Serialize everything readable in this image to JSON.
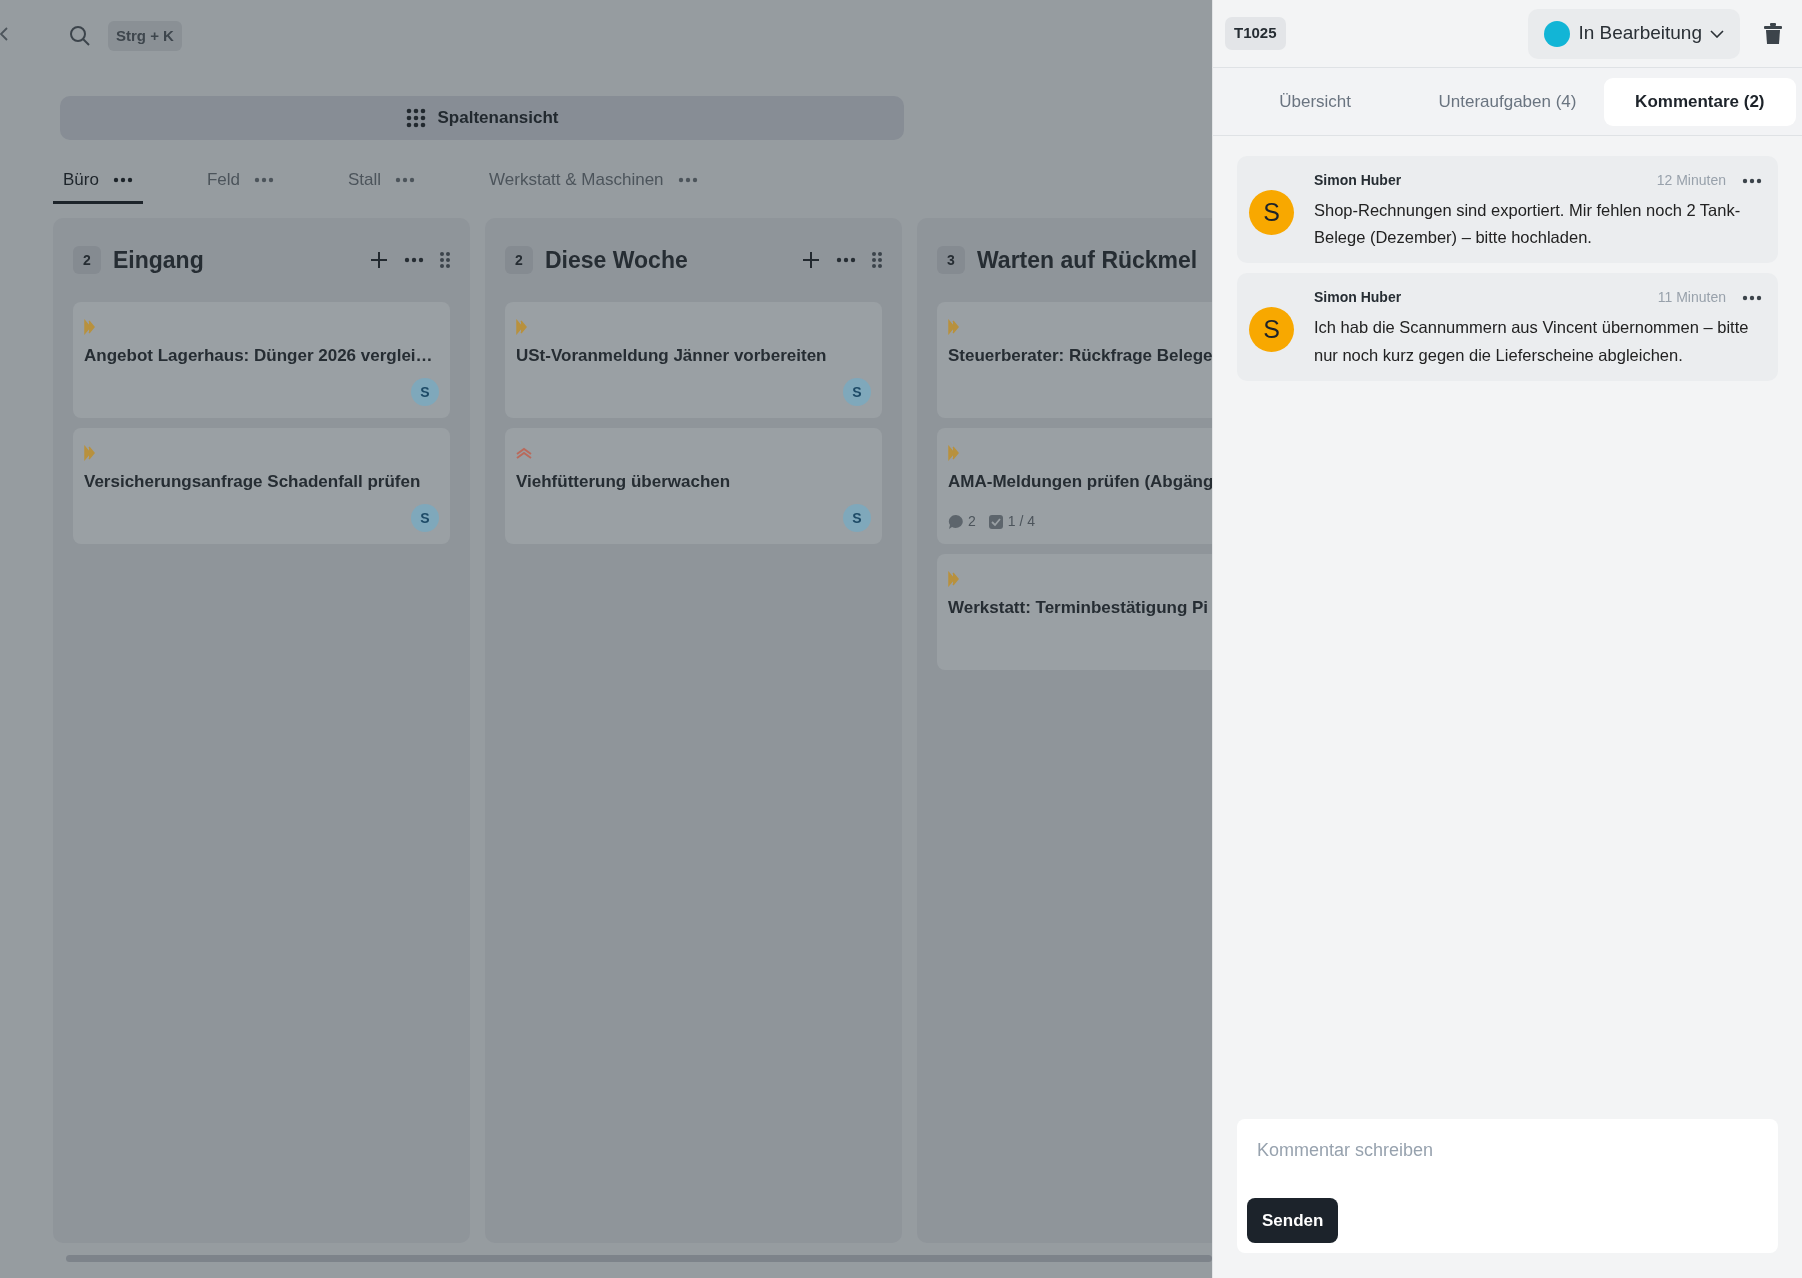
{
  "topbar": {
    "shortcut": "Strg + K"
  },
  "view_switch": {
    "label": "Spaltenansicht"
  },
  "boards": [
    {
      "label": "Büro",
      "selected": true
    },
    {
      "label": "Feld",
      "selected": false
    },
    {
      "label": "Stall",
      "selected": false
    },
    {
      "label": "Werkstatt & Maschinen",
      "selected": false
    }
  ],
  "columns": [
    {
      "count": "2",
      "title": "Eingang",
      "actions_visible": true,
      "cards": [
        {
          "kind": "medium",
          "title": "Angebot Lagerhaus: Dünger 2026 verglei…",
          "assignee": "S"
        },
        {
          "kind": "medium",
          "title": "Versicherungsanfrage Schadenfall prüfen",
          "assignee": "S"
        }
      ]
    },
    {
      "count": "2",
      "title": "Diese Woche",
      "actions_visible": true,
      "cards": [
        {
          "kind": "medium",
          "title": "USt-Voranmeldung Jänner vorbereiten",
          "assignee": "S"
        },
        {
          "kind": "high",
          "title": "Viehfütterung überwachen",
          "assignee": "S"
        }
      ]
    },
    {
      "count": "3",
      "title": "Warten auf Rückmel",
      "actions_visible": false,
      "cards": [
        {
          "kind": "medium",
          "title": "Steuerberater: Rückfrage Belege"
        },
        {
          "kind": "medium",
          "title": "AMA-Meldungen prüfen (Abgäng",
          "comments": "2",
          "subtasks": "1 / 4"
        },
        {
          "kind": "medium",
          "title": "Werkstatt: Terminbestätigung Pi"
        }
      ]
    }
  ],
  "panel": {
    "task_id": "T1025",
    "status": {
      "label": "In Bearbeitung",
      "color": "#12b5d6"
    },
    "tabs": [
      {
        "label": "Übersicht",
        "selected": false
      },
      {
        "label": "Unteraufgaben (4)",
        "selected": false
      },
      {
        "label": "Kommentare (2)",
        "selected": true
      }
    ],
    "comments": [
      {
        "initial": "S",
        "author": "Simon Huber",
        "time": "12 Minuten",
        "text": "Shop-Rechnungen sind exportiert. Mir fehlen noch 2 Tank-Belege (Dezember) – bitte hochladen."
      },
      {
        "initial": "S",
        "author": "Simon Huber",
        "time": "11 Minuten",
        "text": "Ich hab die Scannummern aus Vincent übernommen – bitte nur noch kurz gegen die Lieferscheine abgleichen."
      }
    ],
    "composer": {
      "placeholder": "Kommentar schreiben",
      "button": "Senden"
    }
  }
}
